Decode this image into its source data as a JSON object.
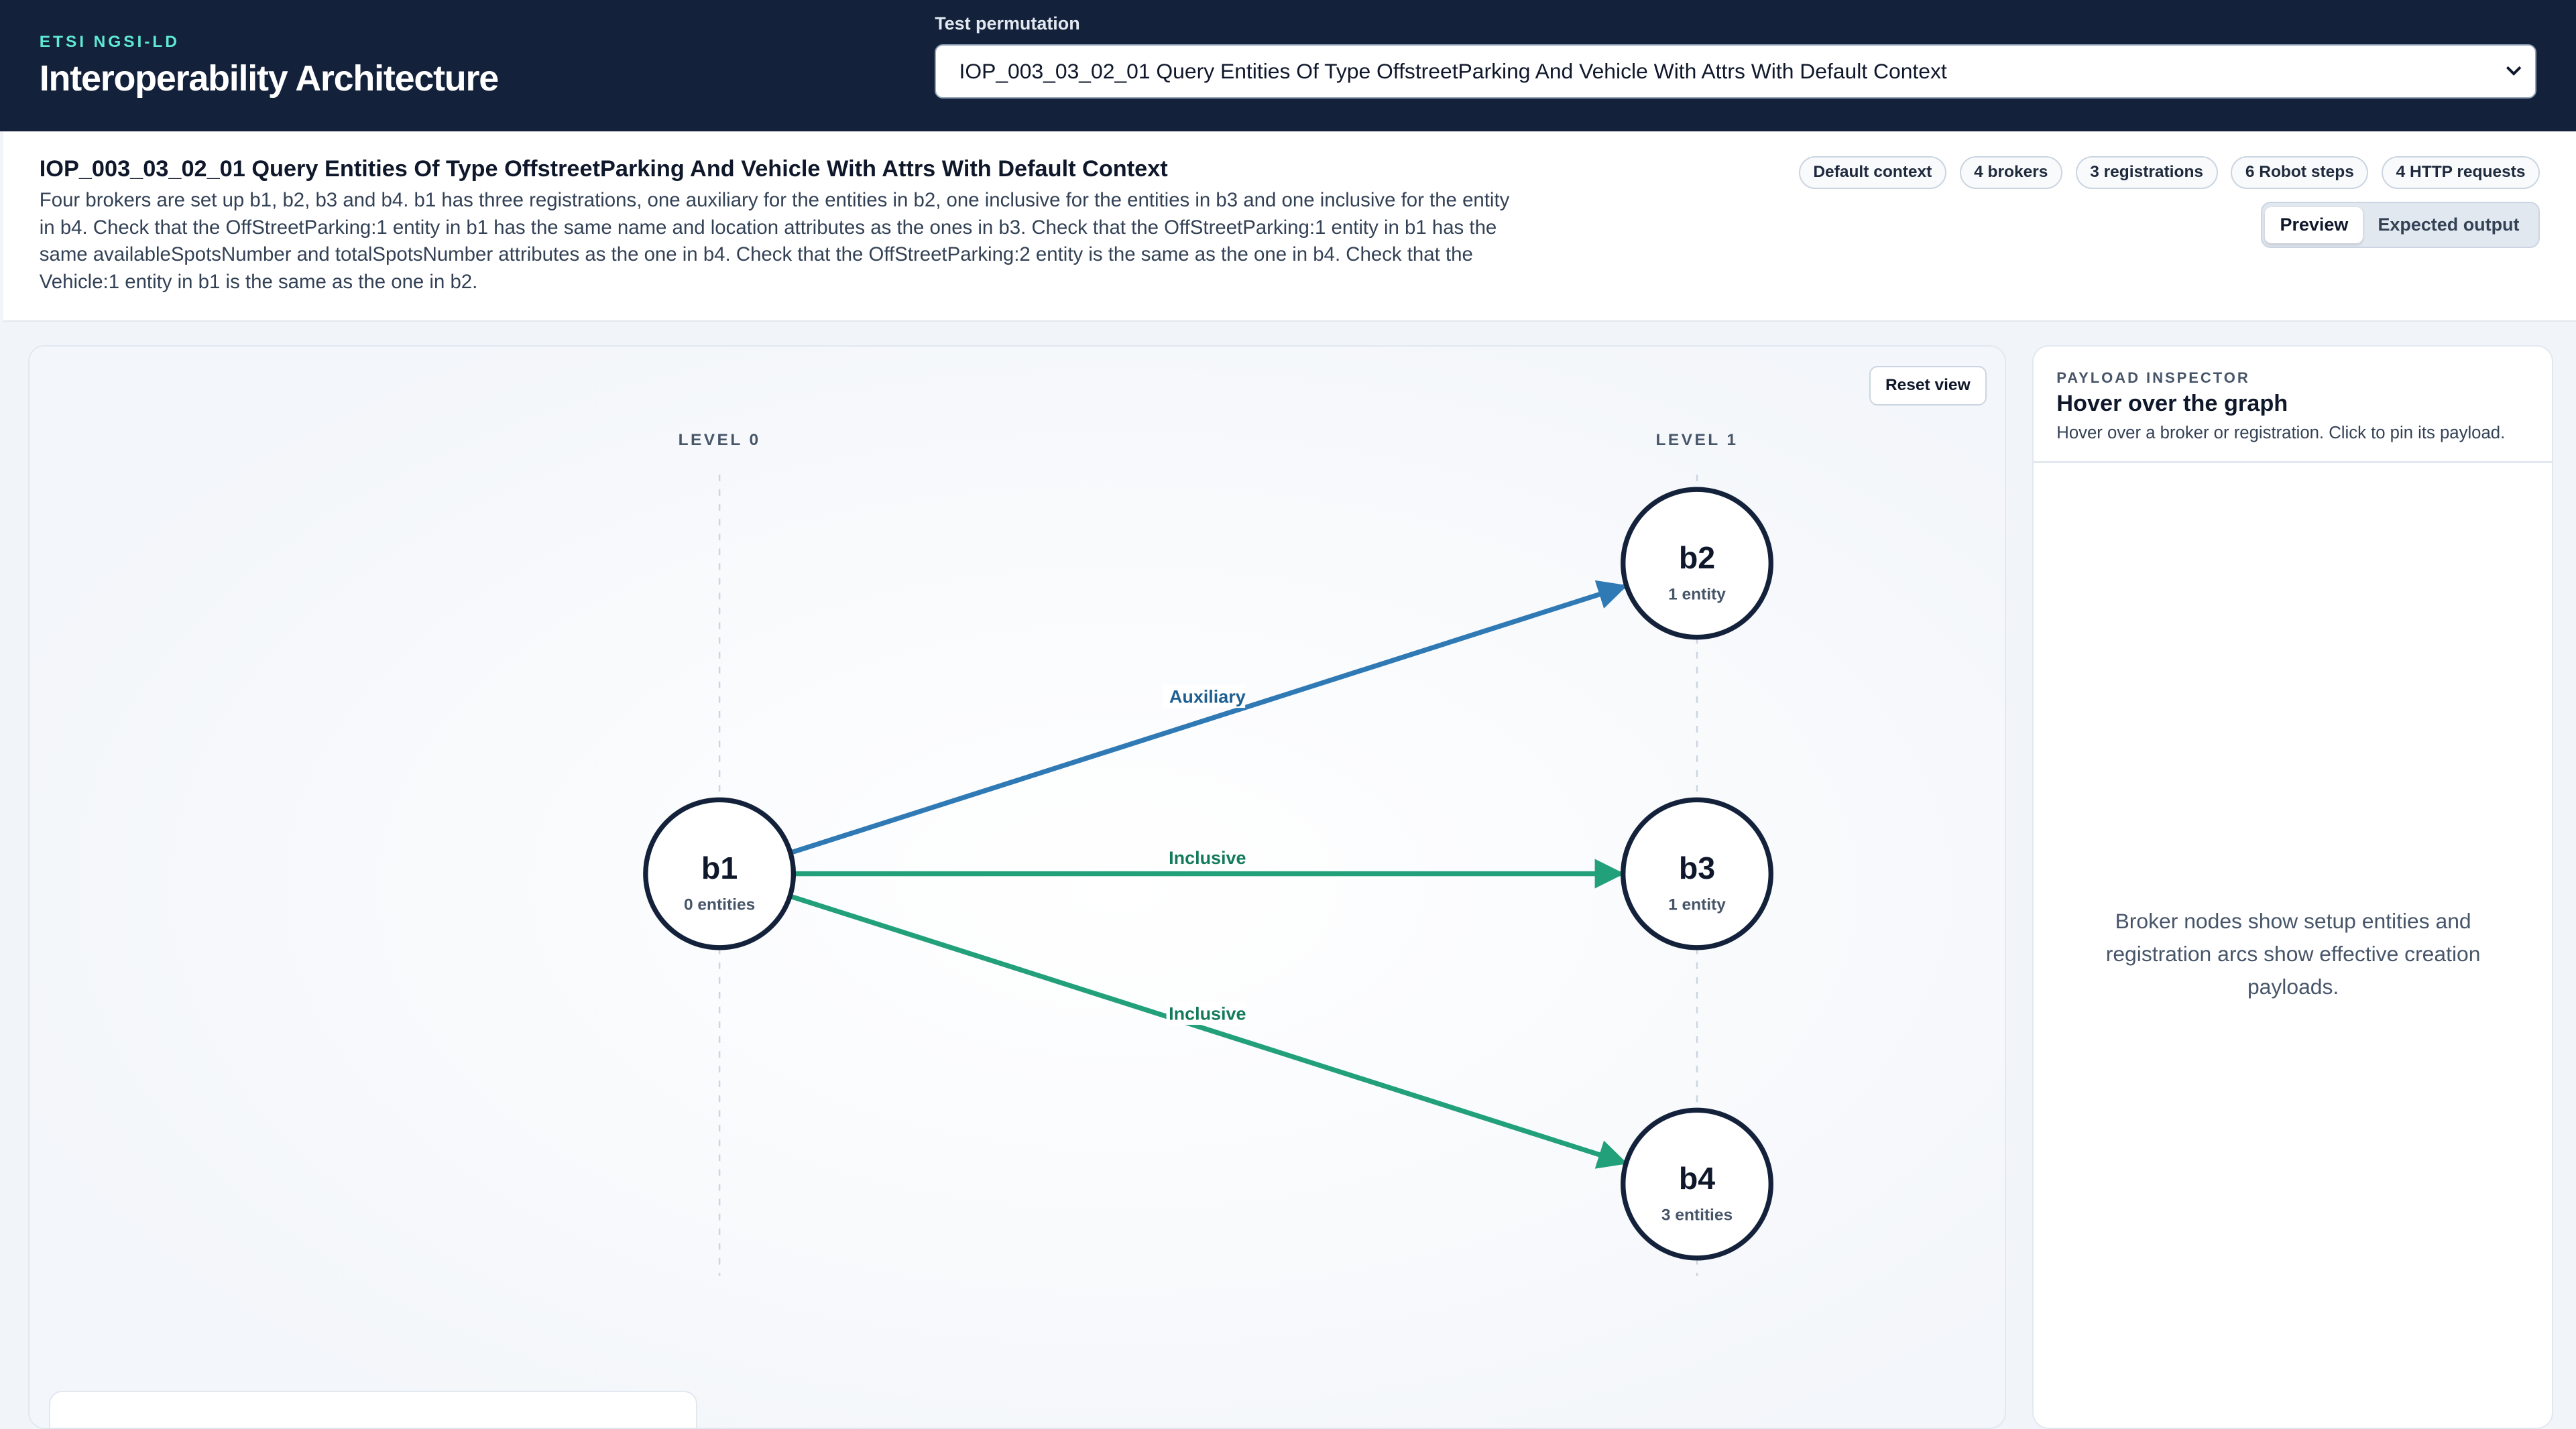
{
  "header": {
    "eyebrow": "ETSI NGSI-LD",
    "title": "Interoperability Architecture",
    "permutation_label": "Test permutation",
    "permutation_value": "IOP_003_03_02_01 Query Entities Of Type OffstreetParking And Vehicle With Attrs With Default Context"
  },
  "summary": {
    "title": "IOP_003_03_02_01 Query Entities Of Type OffstreetParking And Vehicle With Attrs With Default Context",
    "description": "Four brokers are set up b1, b2, b3 and b4. b1 has three registrations, one auxiliary for the entities in b2, one inclusive for the entities in b3 and one inclusive for the entity in b4. Check that the OffStreetParking:1 entity in b1 has the same name and location attributes as the ones in b3. Check that the OffStreetParking:1 entity in b1 has the same availableSpotsNumber and totalSpotsNumber attributes as the one in b4. Check that the OffStreetParking:2 entity is the same as the one in b4. Check that the Vehicle:1 entity in b1 is the same as the one in b2.",
    "chips": [
      "Default context",
      "4 brokers",
      "3 registrations",
      "6 Robot steps",
      "4 HTTP requests"
    ],
    "view_tabs": [
      "Preview",
      "Expected output"
    ],
    "active_tab": "Preview"
  },
  "graph": {
    "reset_label": "Reset view",
    "levels": [
      "LEVEL 0",
      "LEVEL 1"
    ],
    "brokers": [
      {
        "id": "b1",
        "count": "0 entities",
        "level": 0
      },
      {
        "id": "b2",
        "count": "1 entity",
        "level": 1
      },
      {
        "id": "b3",
        "count": "1 entity",
        "level": 1
      },
      {
        "id": "b4",
        "count": "3 entities",
        "level": 1
      }
    ],
    "registrations": [
      {
        "from": "b1",
        "to": "b2",
        "label": "Auxiliary",
        "color": "#2f7ab5"
      },
      {
        "from": "b1",
        "to": "b3",
        "label": "Inclusive",
        "color": "#22a07a"
      },
      {
        "from": "b1",
        "to": "b4",
        "label": "Inclusive",
        "color": "#22a07a"
      }
    ],
    "colors": {
      "auxiliary": "#2f7ab5",
      "inclusive": "#22a07a",
      "node_stroke": "#13213a"
    }
  },
  "inspector": {
    "eyebrow": "PAYLOAD INSPECTOR",
    "title": "Hover over the graph",
    "subtitle": "Hover over a broker or registration. Click to pin its payload.",
    "empty_text": "Broker nodes show setup entities and registration arcs show effective creation payloads."
  }
}
